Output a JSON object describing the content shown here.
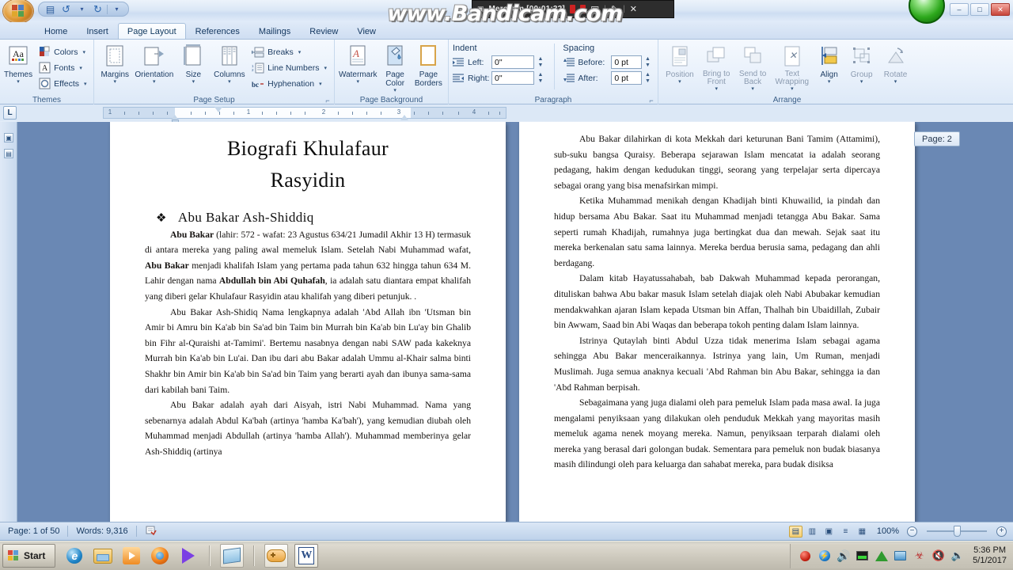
{
  "window": {
    "titlebar_caption": "",
    "min_label": "–",
    "max_label": "□",
    "close_label": "✕"
  },
  "quick_access": {
    "office_button": "office-orb",
    "save_label": "💾",
    "undo_label": "↺",
    "redo_label": "↻",
    "customize_label": "▾"
  },
  "tabs": [
    {
      "label": "Home",
      "active": false
    },
    {
      "label": "Insert",
      "active": false
    },
    {
      "label": "Page Layout",
      "active": true
    },
    {
      "label": "References",
      "active": false
    },
    {
      "label": "Mailings",
      "active": false
    },
    {
      "label": "Review",
      "active": false
    },
    {
      "label": "View",
      "active": false
    }
  ],
  "ribbon": {
    "groups": [
      {
        "name": "Themes",
        "label": "Themes",
        "big": [
          {
            "label": "Themes",
            "icon": "themes-icon",
            "arrow": "▾"
          }
        ],
        "small": [
          {
            "label": "Colors",
            "icon": "colors-icon",
            "arrow": "▾"
          },
          {
            "label": "Fonts",
            "icon": "fonts-icon",
            "arrow": "▾"
          },
          {
            "label": "Effects",
            "icon": "effects-icon",
            "arrow": "▾"
          }
        ],
        "launcher": ""
      },
      {
        "name": "Page Setup",
        "label": "Page Setup",
        "big": [
          {
            "label": "Margins",
            "icon": "margins-icon",
            "arrow": "▾"
          },
          {
            "label": "Orientation",
            "icon": "orientation-icon",
            "arrow": "▾"
          },
          {
            "label": "Size",
            "icon": "size-icon",
            "arrow": "▾"
          },
          {
            "label": "Columns",
            "icon": "columns-icon",
            "arrow": "▾"
          }
        ],
        "small": [
          {
            "label": "Breaks",
            "icon": "breaks-icon",
            "arrow": "▾"
          },
          {
            "label": "Line Numbers",
            "icon": "line-numbers-icon",
            "arrow": "▾"
          },
          {
            "label": "Hyphenation",
            "icon": "hyphenation-icon",
            "arrow": "▾"
          }
        ],
        "launcher": "⌐"
      },
      {
        "name": "Page Background",
        "label": "Page Background",
        "big": [
          {
            "label": "Watermark",
            "icon": "watermark-icon",
            "arrow": "▾"
          },
          {
            "label": "Page Color",
            "icon": "page-color-icon",
            "arrow": "▾"
          },
          {
            "label": "Page Borders",
            "icon": "page-borders-icon",
            "arrow": ""
          }
        ],
        "small": [],
        "launcher": ""
      },
      {
        "name": "Arrange",
        "label": "Arrange",
        "big": [
          {
            "label": "Position",
            "icon": "position-icon",
            "arrow": "▾"
          },
          {
            "label": "Bring to Front",
            "icon": "bring-to-front-icon",
            "arrow": "▾"
          },
          {
            "label": "Send to Back",
            "icon": "send-to-back-icon",
            "arrow": "▾"
          },
          {
            "label": "Text Wrapping",
            "icon": "text-wrapping-icon",
            "arrow": "▾"
          },
          {
            "label": "Align",
            "icon": "align-icon",
            "arrow": "▾"
          },
          {
            "label": "Group",
            "icon": "group-icon",
            "arrow": "▾"
          },
          {
            "label": "Rotate",
            "icon": "rotate-icon",
            "arrow": "▾"
          }
        ],
        "small": [],
        "launcher": ""
      }
    ],
    "paragraph_group": {
      "label": "Paragraph",
      "indent_header": "Indent",
      "spacing_header": "Spacing",
      "left_label": "Left:",
      "left_value": "0\"",
      "right_label": "Right:",
      "right_value": "0\"",
      "before_label": "Before:",
      "before_value": "0 pt",
      "after_label": "After:",
      "after_value": "0 pt",
      "launcher": "⌐"
    }
  },
  "ruler": {
    "tabstop_marker": "L",
    "numbers": [
      "1",
      "1",
      "2",
      "3",
      "4"
    ]
  },
  "document": {
    "title_lines": [
      "Biografi Khulafaur",
      "Rasyidin"
    ],
    "heading_bullet": "❖",
    "heading": "Abu Bakar  Ash-Shiddiq",
    "left_page_paragraphs": [
      "<b>Abu  Bakar</b> (lahir: 572 - wafat: 23 Agustus 634/21 Jumadil Akhir 13 H) termasuk di antara mereka yang paling awal memeluk Islam. Setelah Nabi Muhammad wafat, <b>Abu Bakar</b> menjadi khalifah Islam yang pertama pada tahun 632 hingga tahun 634 M. Lahir dengan nama <b>Abdullah bin Abi Quhafah</b>, ia adalah satu diantara empat khalifah yang diberi gelar Khulafaur Rasyidin atau khalifah yang diberi petunjuk. .",
      "Abu Bakar Ash-Shidiq Nama lengkapnya adalah 'Abd Allah ibn 'Utsman bin Amir bi Amru bin Ka'ab bin Sa'ad bin Taim bin Murrah bin Ka'ab bin Lu'ay bin Ghalib bin Fihr al-Quraishi at-Tamimi'. Bertemu nasabnya dengan nabi SAW pada kakeknya Murrah bin Ka'ab bin Lu'ai. Dan ibu dari abu Bakar adalah Ummu al-Khair salma binti Shakhr bin Amir bin Ka'ab bin Sa'ad bin Taim yang berarti ayah dan ibunya sama-sama dari kabilah bani Taim.",
      "Abu Bakar adalah ayah dari Aisyah, istri Nabi Muhammad. Nama yang sebenarnya adalah Abdul Ka'bah (artinya 'hamba Ka'bah'), yang kemudian diubah oleh Muhammad menjadi Abdullah (artinya 'hamba Allah'). Muhammad memberinya gelar Ash-Shiddiq (artinya"
    ],
    "right_page_paragraphs": [
      "Abu Bakar dilahirkan di kota Mekkah dari keturunan Bani Tamim (Attamimi), sub-suku bangsa Quraisy. Beberapa sejarawan Islam mencatat ia adalah seorang pedagang, hakim dengan kedudukan tinggi, seorang yang terpelajar serta dipercaya sebagai orang yang bisa menafsirkan mimpi.",
      "Ketika Muhammad menikah dengan Khadijah binti Khuwailid, ia pindah dan hidup bersama Abu Bakar. Saat itu Muhammad menjadi tetangga Abu Bakar. Sama seperti rumah Khadijah, rumahnya juga bertingkat dua dan mewah. Sejak saat itu mereka berkenalan satu sama lainnya. Mereka berdua berusia sama, pedagang dan ahli berdagang.",
      "Dalam kitab Hayatussahabah, bab Dakwah Muhammad kepada perorangan, dituliskan bahwa Abu bakar masuk Islam setelah diajak oleh Nabi Abubakar kemudian mendakwahkan ajaran Islam kepada Utsman bin Affan, Thalhah bin Ubaidillah, Zubair bin Awwam, Saad bin Abi Waqas dan beberapa tokoh penting dalam Islam lainnya.",
      "Istrinya Qutaylah binti Abdul Uzza tidak menerima Islam sebagai agama sehingga Abu Bakar menceraikannya. Istrinya yang lain, Um Ruman, menjadi Muslimah. Juga semua anaknya kecuali 'Abd Rahman bin Abu Bakar, sehingga ia dan 'Abd Rahman berpisah.",
      "Sebagaimana yang juga dialami oleh para pemeluk Islam pada masa awal. Ia juga mengalami penyiksaan yang dilakukan oleh penduduk Mekkah yang mayoritas masih memeluk agama nenek moyang mereka. Namun, penyiksaan terparah dialami oleh mereka yang berasal dari golongan budak. Sementara para pemeluk non budak biasanya masih dilindungi oleh para keluarga dan sahabat mereka, para budak disiksa"
    ],
    "page_tooltip": "Page: 2"
  },
  "statusbar": {
    "page_info": "Page: 1 of 50",
    "word_count": "Words: 9,316",
    "proofing_icon": "proofing-errors-icon",
    "views": [
      {
        "name": "print-layout",
        "glyph": "▤",
        "selected": true
      },
      {
        "name": "full-screen-reading",
        "glyph": "▥",
        "selected": false
      },
      {
        "name": "web-layout",
        "glyph": "▣",
        "selected": false
      },
      {
        "name": "outline",
        "glyph": "≡",
        "selected": false
      },
      {
        "name": "draft",
        "glyph": "▦",
        "selected": false
      }
    ],
    "zoom_level": "100%",
    "zoom_out": "−",
    "zoom_in": "+"
  },
  "bandicam": {
    "status_text": "Merekam [00:01:32]",
    "camera_icon": "camera-icon",
    "pencil_icon": "pencil-icon",
    "close_icon": "✕",
    "separator": "|",
    "watermark": "www.Bandicam.com"
  },
  "taskbar": {
    "start_label": "Start",
    "quick_launch": [
      {
        "name": "internet-explorer-icon"
      },
      {
        "name": "file-explorer-icon"
      },
      {
        "name": "windows-media-player-icon"
      },
      {
        "name": "firefox-icon"
      },
      {
        "name": "media-play-icon"
      },
      {
        "name": "notes-app-icon"
      },
      {
        "name": "game-controller-icon"
      }
    ],
    "running_apps": [
      {
        "name": "microsoft-word-icon",
        "glyph": "W"
      }
    ],
    "tray_icons": [
      {
        "name": "bandicam-record-icon"
      },
      {
        "name": "blue-sync-icon"
      },
      {
        "name": "volume-red-icon"
      },
      {
        "name": "equalizer-icon"
      },
      {
        "name": "green-triangle-icon"
      },
      {
        "name": "network-screen-icon"
      },
      {
        "name": "virus-shield-icon"
      },
      {
        "name": "sound-muted-icon"
      },
      {
        "name": "speaker-icon"
      }
    ],
    "clock_time": "5:36 PM",
    "clock_date": "5/1/2017"
  }
}
